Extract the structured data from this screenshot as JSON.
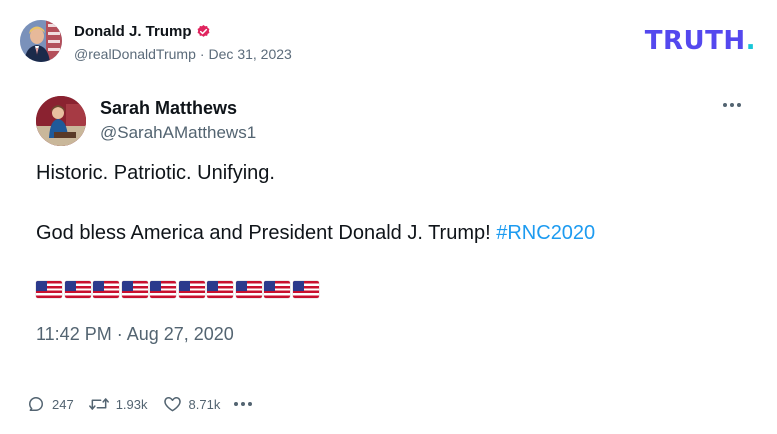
{
  "post": {
    "author_name": "Donald J. Trump",
    "handle": "@realDonaldTrump",
    "separator": "·",
    "date": "Dec 31, 2023"
  },
  "brand": {
    "logo_text": "TRUTH",
    "logo_dot": ".",
    "colors": {
      "primary": "#5448ee",
      "dot": "#17c6d8"
    }
  },
  "quote": {
    "name": "Sarah Matthews",
    "handle": "@SarahAMatthews1",
    "line1": "Historic. Patriotic. Unifying.",
    "line2_text": "God bless America and President Donald J. Trump! ",
    "hashtag": "#RNC2020",
    "flags": [
      "🇺🇸",
      "🇺🇸",
      "🇺🇸",
      "🇺🇸",
      "🇺🇸",
      "🇺🇸",
      "🇺🇸",
      "🇺🇸",
      "🇺🇸",
      "🇺🇸"
    ],
    "timestamp": "11:42 PM · Aug 27, 2020"
  },
  "actions": {
    "replies": "247",
    "retweets": "1.93k",
    "likes": "8.71k"
  },
  "icons": {
    "verified": "verified-badge-icon",
    "reply": "speech-bubble-icon",
    "retweet": "retweet-icon",
    "like": "heart-icon",
    "more": "ellipsis-icon"
  },
  "colors": {
    "hashtag": "#1d9bf0",
    "verified": "#e0245e",
    "muted_text": "#536471"
  }
}
